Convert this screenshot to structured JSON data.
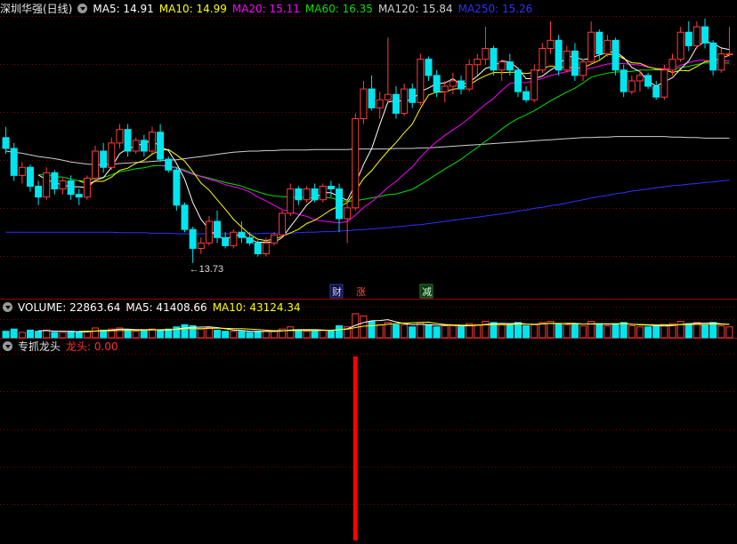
{
  "header": {
    "stock_name": "深圳华强(日线)",
    "ma_items": [
      {
        "label": "MA5: 14.91",
        "color": "#ffffff"
      },
      {
        "label": "MA10: 14.99",
        "color": "#ffff00"
      },
      {
        "label": "MA20: 15.11",
        "color": "#ff00ff"
      },
      {
        "label": "MA60: 16.35",
        "color": "#00e000"
      },
      {
        "label": "MA120: 15.84",
        "color": "#d0d0d0"
      },
      {
        "label": "MA250: 15.26",
        "color": "#3030ff"
      }
    ]
  },
  "volume_header": {
    "items": [
      {
        "label": "VOLUME: 22863.64",
        "color": "#ffffff"
      },
      {
        "label": "MA5: 41408.66",
        "color": "#ffffff"
      },
      {
        "label": "MA10: 43124.34",
        "color": "#ffff00"
      }
    ]
  },
  "indicator_header": {
    "name": "专抓龙头",
    "value_label": "龙头: 0.00",
    "value_color": "#ff3030"
  },
  "annotations": {
    "low_price": "←13.73",
    "tag_cai": "财",
    "tag_zhang": "涨",
    "tag_jian": "减"
  },
  "colors": {
    "up": "#ff3c3c",
    "down": "#00e5ee",
    "grid": "#7a0000",
    "divider": "#a00000",
    "signal": "#ff0000"
  },
  "chart_data": {
    "type": "candlestick",
    "title": "深圳华强(日线)",
    "price_range": [
      13.3,
      18.3
    ],
    "ohlc": [
      [
        16.05,
        16.25,
        15.75,
        15.85
      ],
      [
        15.85,
        15.95,
        15.25,
        15.35
      ],
      [
        15.35,
        15.6,
        15.2,
        15.5
      ],
      [
        15.5,
        15.55,
        15.05,
        15.15
      ],
      [
        15.15,
        15.25,
        14.8,
        14.95
      ],
      [
        14.95,
        15.5,
        14.9,
        15.4
      ],
      [
        15.4,
        15.45,
        15.0,
        15.1
      ],
      [
        15.1,
        15.3,
        15.0,
        15.25
      ],
      [
        15.25,
        15.35,
        14.9,
        15.0
      ],
      [
        15.0,
        15.1,
        14.8,
        14.95
      ],
      [
        14.95,
        15.35,
        14.9,
        15.3
      ],
      [
        15.3,
        15.9,
        15.25,
        15.8
      ],
      [
        15.8,
        15.95,
        15.4,
        15.5
      ],
      [
        15.5,
        16.05,
        15.45,
        15.95
      ],
      [
        15.95,
        16.3,
        15.85,
        16.2
      ],
      [
        16.2,
        16.3,
        15.7,
        15.8
      ],
      [
        15.8,
        16.05,
        15.75,
        16.0
      ],
      [
        16.0,
        16.1,
        15.7,
        15.8
      ],
      [
        15.8,
        16.25,
        15.75,
        16.15
      ],
      [
        16.15,
        16.3,
        15.6,
        15.65
      ],
      [
        15.65,
        15.7,
        15.4,
        15.45
      ],
      [
        15.45,
        15.5,
        14.7,
        14.8
      ],
      [
        14.8,
        14.85,
        14.3,
        14.35
      ],
      [
        14.35,
        14.4,
        13.73,
        14.0
      ],
      [
        14.0,
        14.2,
        13.9,
        14.1
      ],
      [
        14.1,
        14.6,
        14.05,
        14.5
      ],
      [
        14.5,
        14.7,
        14.1,
        14.2
      ],
      [
        14.2,
        14.3,
        14.0,
        14.05
      ],
      [
        14.05,
        14.35,
        14.0,
        14.3
      ],
      [
        14.3,
        14.5,
        14.1,
        14.2
      ],
      [
        14.2,
        14.3,
        14.05,
        14.1
      ],
      [
        14.1,
        14.15,
        13.85,
        13.9
      ],
      [
        13.9,
        14.2,
        13.85,
        14.1
      ],
      [
        14.1,
        14.3,
        14.05,
        14.25
      ],
      [
        14.25,
        14.7,
        14.2,
        14.65
      ],
      [
        14.65,
        15.2,
        14.6,
        15.1
      ],
      [
        15.1,
        15.15,
        14.8,
        14.9
      ],
      [
        14.9,
        15.15,
        14.85,
        15.1
      ],
      [
        15.1,
        15.2,
        14.85,
        14.9
      ],
      [
        14.9,
        15.2,
        14.85,
        15.15
      ],
      [
        15.15,
        15.25,
        14.95,
        15.1
      ],
      [
        15.1,
        15.2,
        14.3,
        14.55
      ],
      [
        14.55,
        14.9,
        14.1,
        14.75
      ],
      [
        14.75,
        16.5,
        14.7,
        16.4
      ],
      [
        16.4,
        17.1,
        16.3,
        16.95
      ],
      [
        16.95,
        17.2,
        16.55,
        16.6
      ],
      [
        16.6,
        16.9,
        16.4,
        16.75
      ],
      [
        16.75,
        17.9,
        16.7,
        16.85
      ],
      [
        16.85,
        17.0,
        16.4,
        16.5
      ],
      [
        16.5,
        17.05,
        16.45,
        16.95
      ],
      [
        16.95,
        17.05,
        16.6,
        16.7
      ],
      [
        16.7,
        17.6,
        16.65,
        17.5
      ],
      [
        17.5,
        17.55,
        17.1,
        17.2
      ],
      [
        17.2,
        17.3,
        16.8,
        16.9
      ],
      [
        16.9,
        17.1,
        16.7,
        17.0
      ],
      [
        17.0,
        17.25,
        16.85,
        17.1
      ],
      [
        17.1,
        17.2,
        16.85,
        16.95
      ],
      [
        16.95,
        17.5,
        16.9,
        17.4
      ],
      [
        17.4,
        17.6,
        17.2,
        17.5
      ],
      [
        17.5,
        18.1,
        17.4,
        17.7
      ],
      [
        17.7,
        17.75,
        17.2,
        17.3
      ],
      [
        17.3,
        17.5,
        17.1,
        17.45
      ],
      [
        17.45,
        17.6,
        17.2,
        17.3
      ],
      [
        17.3,
        17.35,
        16.8,
        16.9
      ],
      [
        16.9,
        17.0,
        16.7,
        16.75
      ],
      [
        16.75,
        17.4,
        16.7,
        17.3
      ],
      [
        17.3,
        17.8,
        17.25,
        17.7
      ],
      [
        17.7,
        18.2,
        17.6,
        17.85
      ],
      [
        17.85,
        17.95,
        17.2,
        17.3
      ],
      [
        17.3,
        17.75,
        17.25,
        17.65
      ],
      [
        17.65,
        17.8,
        17.1,
        17.2
      ],
      [
        17.2,
        17.5,
        17.1,
        17.45
      ],
      [
        17.45,
        18.2,
        17.4,
        18.0
      ],
      [
        18.0,
        18.05,
        17.5,
        17.6
      ],
      [
        17.6,
        17.95,
        17.55,
        17.85
      ],
      [
        17.85,
        17.9,
        17.2,
        17.3
      ],
      [
        17.3,
        17.4,
        16.8,
        16.9
      ],
      [
        16.9,
        17.2,
        16.85,
        17.1
      ],
      [
        17.1,
        17.3,
        16.9,
        17.2
      ],
      [
        17.2,
        17.25,
        16.95,
        17.0
      ],
      [
        17.0,
        17.1,
        16.75,
        16.8
      ],
      [
        16.8,
        17.4,
        16.75,
        17.3
      ],
      [
        17.3,
        17.6,
        17.2,
        17.5
      ],
      [
        17.5,
        18.1,
        17.45,
        18.0
      ],
      [
        18.0,
        18.2,
        17.65,
        17.75
      ],
      [
        17.75,
        18.2,
        17.7,
        18.1
      ],
      [
        18.1,
        18.25,
        17.7,
        17.8
      ],
      [
        17.8,
        17.85,
        17.2,
        17.3
      ],
      [
        17.3,
        17.7,
        17.25,
        17.6
      ],
      [
        17.6,
        18.1,
        17.55,
        17.6
      ]
    ],
    "volume": [
      0.6,
      0.8,
      0.5,
      0.7,
      0.6,
      0.7,
      0.5,
      0.5,
      0.6,
      0.5,
      0.6,
      0.9,
      0.7,
      0.8,
      0.9,
      0.7,
      0.6,
      0.7,
      0.8,
      0.7,
      0.8,
      1.0,
      1.2,
      1.1,
      0.8,
      0.9,
      0.7,
      0.6,
      0.6,
      0.6,
      0.5,
      0.6,
      0.6,
      0.6,
      0.8,
      1.0,
      0.7,
      0.6,
      0.6,
      0.7,
      0.7,
      1.1,
      1.0,
      2.2,
      2.0,
      1.5,
      1.2,
      1.4,
      1.2,
      1.2,
      1.0,
      1.4,
      1.2,
      1.0,
      1.1,
      1.1,
      1.0,
      1.3,
      1.2,
      1.5,
      1.4,
      1.2,
      1.2,
      1.4,
      1.1,
      1.2,
      1.4,
      1.5,
      1.3,
      1.2,
      1.2,
      1.1,
      1.5,
      1.3,
      1.1,
      1.3,
      1.4,
      1.1,
      1.0,
      1.0,
      1.1,
      1.2,
      1.3,
      1.5,
      1.3,
      1.4,
      1.2,
      1.4,
      1.1,
      1.0
    ],
    "ma120_series": [
      15.8,
      15.78,
      15.76,
      15.73,
      15.7,
      15.68,
      15.66,
      15.63,
      15.6,
      15.58,
      15.56,
      15.55,
      15.55,
      15.56,
      15.57,
      15.58,
      15.59,
      15.6,
      15.61,
      15.62,
      15.63,
      15.64,
      15.66,
      15.68,
      15.7,
      15.72,
      15.74,
      15.76,
      15.78,
      15.79,
      15.8,
      15.8,
      15.81,
      15.81,
      15.82,
      15.82,
      15.82,
      15.82,
      15.83,
      15.83,
      15.83,
      15.83,
      15.83,
      15.84,
      15.84,
      15.84,
      15.84,
      15.84,
      15.85,
      15.85,
      15.85,
      15.86,
      15.86,
      15.87,
      15.88,
      15.89,
      15.9,
      15.91,
      15.92,
      15.93,
      15.94,
      15.95,
      15.96,
      15.97,
      15.98,
      15.99,
      16.0,
      16.01,
      16.02,
      16.03,
      16.04,
      16.05,
      16.05,
      16.06,
      16.06,
      16.07,
      16.07,
      16.07,
      16.07,
      16.07,
      16.07,
      16.07,
      16.06,
      16.06,
      16.05,
      16.05,
      16.04,
      16.04,
      16.04,
      16.04
    ],
    "ma250_series": [
      14.3,
      14.3,
      14.3,
      14.3,
      14.3,
      14.3,
      14.3,
      14.3,
      14.3,
      14.3,
      14.3,
      14.3,
      14.3,
      14.3,
      14.29,
      14.29,
      14.29,
      14.29,
      14.28,
      14.28,
      14.28,
      14.27,
      14.27,
      14.27,
      14.27,
      14.27,
      14.27,
      14.27,
      14.27,
      14.27,
      14.27,
      14.27,
      14.28,
      14.28,
      14.28,
      14.28,
      14.29,
      14.3,
      14.3,
      14.31,
      14.31,
      14.32,
      14.33,
      14.34,
      14.35,
      14.36,
      14.37,
      14.38,
      14.4,
      14.41,
      14.43,
      14.44,
      14.46,
      14.48,
      14.5,
      14.52,
      14.54,
      14.56,
      14.58,
      14.6,
      14.62,
      14.64,
      14.66,
      14.69,
      14.71,
      14.74,
      14.76,
      14.79,
      14.81,
      14.84,
      14.87,
      14.9,
      14.93,
      14.96,
      14.98,
      15.01,
      15.03,
      15.06,
      15.08,
      15.1,
      15.12,
      15.14,
      15.16,
      15.17,
      15.19,
      15.2,
      15.22,
      15.23,
      15.25,
      15.26
    ],
    "signal_index": 43
  }
}
